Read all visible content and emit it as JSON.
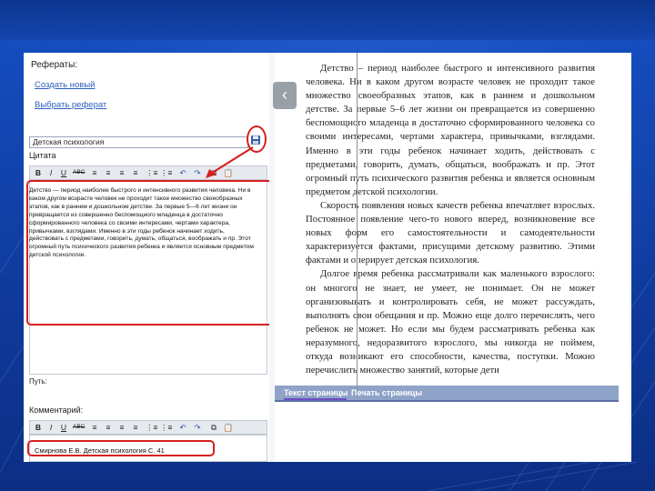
{
  "left_panel": {
    "title": "Рефераты:",
    "links": [
      "Создать новый",
      "Выбрать реферат"
    ],
    "topic_value": "Детская психология",
    "quote_label": "Цитата",
    "quote_text": "Детство — период наиболее быстрого и интенсивного развития человека. Ни в каком другом возрасте человек не проходит такое множество своеобразных этапов, как в раннем и дошкольном детстве. За первые 5—6 лет жизни он превращается из совершенно беспомощного младенца в достаточно сформированного человека со своими интересами, чертами характера, привычками, взглядами. Именно в эти годы ребенок начинает ходить, действовать с предметами, говорить, думать, общаться, воображать и пр. Этот огромный путь психического развития ребенка и является основным предметом детской психологии.",
    "path_label": "Путь:",
    "comment_label": "Комментарий:",
    "comment_text": "Смирнова Е.В. Детская психология С. 41",
    "toolbar": [
      "B",
      "I",
      "U",
      "ABC",
      "≡",
      "≡",
      "≡",
      "≡",
      "⋮≡",
      "⋮≡",
      "↶",
      "↷",
      "⧉",
      "📋"
    ]
  },
  "nav": {
    "prev": "‹"
  },
  "book_page": {
    "paragraphs": [
      "Детство – период наиболее быстрого и интенсивного развития человека. Ни в каком другом возрасте человек не проходит такое множество своеобразных этапов, как в раннем и дошкольном детстве. За первые 5–6 лет жизни он превращается из совершенно беспомощного младенца в достаточно сформированного человека со своими интересами, чертами характера, привычками, взглядами. Именно в эти годы ребенок начинает ходить, действовать с предметами, говорить, думать, общаться, воображать и пр. Этот огромный путь психического развития ребенка и является основным предметом детской психологии.",
      "Скорость появления новых качеств ребенка впечатляет взрослых. Постоянное появление чего-то нового вперед, возникновение все новых форм его самостоятельности и самодеятельности характеризуется фактами, присущими детскому развитию. Этими фактами и оперирует детская психология.",
      "Долгое время ребенка рассматривали как маленького взрослого: он многого не знает, не умеет, не понимает. Он не может организовывать и контролировать себя, не может рассуждать, выполнять свои обещания и пр. Можно еще долго перечислять, чего ребенок не может. Но если мы будем рассматривать ребенка как неразумного, недоразвитого взрослого, мы никогда не поймем, откуда возникают его способности, качества, поступки. Можно перечислить множество занятий, которые дети"
    ],
    "tabs": [
      "Текст страницы",
      "Печать страницы"
    ]
  }
}
